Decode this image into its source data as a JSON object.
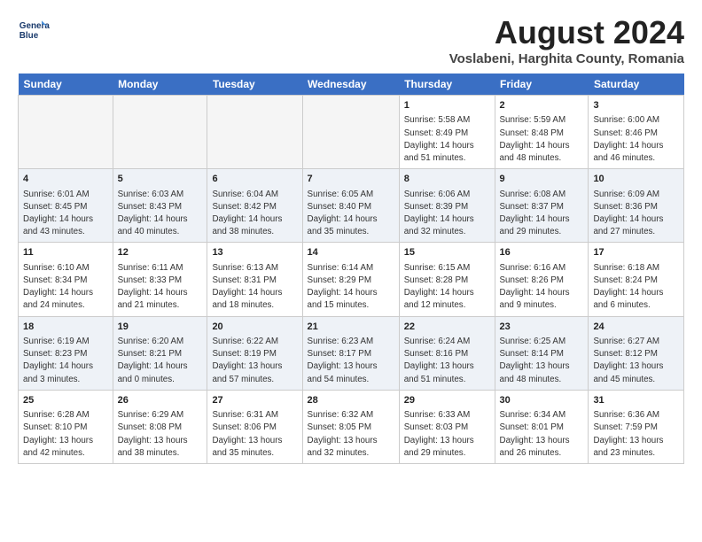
{
  "logo": {
    "line1": "General",
    "line2": "Blue"
  },
  "title": "August 2024",
  "subtitle": "Voslabeni, Harghita County, Romania",
  "days_of_week": [
    "Sunday",
    "Monday",
    "Tuesday",
    "Wednesday",
    "Thursday",
    "Friday",
    "Saturday"
  ],
  "weeks": [
    [
      {
        "day": "",
        "info": ""
      },
      {
        "day": "",
        "info": ""
      },
      {
        "day": "",
        "info": ""
      },
      {
        "day": "",
        "info": ""
      },
      {
        "day": "1",
        "info": "Sunrise: 5:58 AM\nSunset: 8:49 PM\nDaylight: 14 hours\nand 51 minutes."
      },
      {
        "day": "2",
        "info": "Sunrise: 5:59 AM\nSunset: 8:48 PM\nDaylight: 14 hours\nand 48 minutes."
      },
      {
        "day": "3",
        "info": "Sunrise: 6:00 AM\nSunset: 8:46 PM\nDaylight: 14 hours\nand 46 minutes."
      }
    ],
    [
      {
        "day": "4",
        "info": "Sunrise: 6:01 AM\nSunset: 8:45 PM\nDaylight: 14 hours\nand 43 minutes."
      },
      {
        "day": "5",
        "info": "Sunrise: 6:03 AM\nSunset: 8:43 PM\nDaylight: 14 hours\nand 40 minutes."
      },
      {
        "day": "6",
        "info": "Sunrise: 6:04 AM\nSunset: 8:42 PM\nDaylight: 14 hours\nand 38 minutes."
      },
      {
        "day": "7",
        "info": "Sunrise: 6:05 AM\nSunset: 8:40 PM\nDaylight: 14 hours\nand 35 minutes."
      },
      {
        "day": "8",
        "info": "Sunrise: 6:06 AM\nSunset: 8:39 PM\nDaylight: 14 hours\nand 32 minutes."
      },
      {
        "day": "9",
        "info": "Sunrise: 6:08 AM\nSunset: 8:37 PM\nDaylight: 14 hours\nand 29 minutes."
      },
      {
        "day": "10",
        "info": "Sunrise: 6:09 AM\nSunset: 8:36 PM\nDaylight: 14 hours\nand 27 minutes."
      }
    ],
    [
      {
        "day": "11",
        "info": "Sunrise: 6:10 AM\nSunset: 8:34 PM\nDaylight: 14 hours\nand 24 minutes."
      },
      {
        "day": "12",
        "info": "Sunrise: 6:11 AM\nSunset: 8:33 PM\nDaylight: 14 hours\nand 21 minutes."
      },
      {
        "day": "13",
        "info": "Sunrise: 6:13 AM\nSunset: 8:31 PM\nDaylight: 14 hours\nand 18 minutes."
      },
      {
        "day": "14",
        "info": "Sunrise: 6:14 AM\nSunset: 8:29 PM\nDaylight: 14 hours\nand 15 minutes."
      },
      {
        "day": "15",
        "info": "Sunrise: 6:15 AM\nSunset: 8:28 PM\nDaylight: 14 hours\nand 12 minutes."
      },
      {
        "day": "16",
        "info": "Sunrise: 6:16 AM\nSunset: 8:26 PM\nDaylight: 14 hours\nand 9 minutes."
      },
      {
        "day": "17",
        "info": "Sunrise: 6:18 AM\nSunset: 8:24 PM\nDaylight: 14 hours\nand 6 minutes."
      }
    ],
    [
      {
        "day": "18",
        "info": "Sunrise: 6:19 AM\nSunset: 8:23 PM\nDaylight: 14 hours\nand 3 minutes."
      },
      {
        "day": "19",
        "info": "Sunrise: 6:20 AM\nSunset: 8:21 PM\nDaylight: 14 hours\nand 0 minutes."
      },
      {
        "day": "20",
        "info": "Sunrise: 6:22 AM\nSunset: 8:19 PM\nDaylight: 13 hours\nand 57 minutes."
      },
      {
        "day": "21",
        "info": "Sunrise: 6:23 AM\nSunset: 8:17 PM\nDaylight: 13 hours\nand 54 minutes."
      },
      {
        "day": "22",
        "info": "Sunrise: 6:24 AM\nSunset: 8:16 PM\nDaylight: 13 hours\nand 51 minutes."
      },
      {
        "day": "23",
        "info": "Sunrise: 6:25 AM\nSunset: 8:14 PM\nDaylight: 13 hours\nand 48 minutes."
      },
      {
        "day": "24",
        "info": "Sunrise: 6:27 AM\nSunset: 8:12 PM\nDaylight: 13 hours\nand 45 minutes."
      }
    ],
    [
      {
        "day": "25",
        "info": "Sunrise: 6:28 AM\nSunset: 8:10 PM\nDaylight: 13 hours\nand 42 minutes."
      },
      {
        "day": "26",
        "info": "Sunrise: 6:29 AM\nSunset: 8:08 PM\nDaylight: 13 hours\nand 38 minutes."
      },
      {
        "day": "27",
        "info": "Sunrise: 6:31 AM\nSunset: 8:06 PM\nDaylight: 13 hours\nand 35 minutes."
      },
      {
        "day": "28",
        "info": "Sunrise: 6:32 AM\nSunset: 8:05 PM\nDaylight: 13 hours\nand 32 minutes."
      },
      {
        "day": "29",
        "info": "Sunrise: 6:33 AM\nSunset: 8:03 PM\nDaylight: 13 hours\nand 29 minutes."
      },
      {
        "day": "30",
        "info": "Sunrise: 6:34 AM\nSunset: 8:01 PM\nDaylight: 13 hours\nand 26 minutes."
      },
      {
        "day": "31",
        "info": "Sunrise: 6:36 AM\nSunset: 7:59 PM\nDaylight: 13 hours\nand 23 minutes."
      }
    ]
  ]
}
